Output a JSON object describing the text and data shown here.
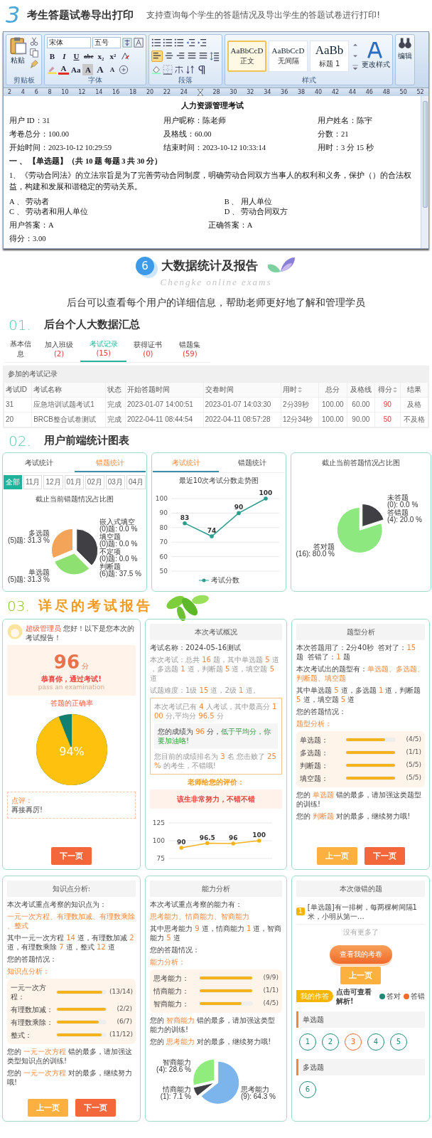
{
  "intro": {
    "number": "3",
    "title": "考生答题试卷导出打印",
    "subtitle": "支持查询每个学生的答题情况及导出学生的答题试卷进行打印!"
  },
  "word": {
    "clipboard": {
      "paste": "粘贴",
      "label": "剪贴板"
    },
    "font": {
      "name": "宋体",
      "size": "五号",
      "label": "字体",
      "row2": [
        {
          "text": "B",
          "kind": "bold"
        },
        {
          "text": "I",
          "kind": "italic"
        },
        {
          "text": "U",
          "kind": "underline"
        },
        {
          "text": "abe",
          "kind": "strike"
        },
        {
          "text": "x₂",
          "kind": "sub"
        },
        {
          "text": "x²",
          "kind": "sup"
        }
      ],
      "row3": [
        {
          "text": "A",
          "kind": "color"
        },
        {
          "text": "Aa",
          "kind": "case"
        },
        {
          "text": "A",
          "kind": "shade"
        },
        {
          "text": "A",
          "kind": "grow"
        },
        {
          "text": "A",
          "kind": "shrink"
        }
      ]
    },
    "paragraph": {
      "label": "段落",
      "align_buttons": [
        {
          "selected": true
        },
        {
          "selected": false
        },
        {
          "selected": false
        },
        {
          "selected": false
        },
        {
          "selected": false
        }
      ]
    },
    "styles": {
      "label": "样式",
      "change": "更改样式",
      "tiles": [
        {
          "sample": "AaBbCcD",
          "name": "正文",
          "kind": "normal",
          "selected": true
        },
        {
          "sample": "AaBbCcD",
          "name": "无间隔",
          "kind": "normal",
          "selected": false
        },
        {
          "sample": "AaBb",
          "name": "标题 1",
          "kind": "heading",
          "selected": false
        }
      ]
    },
    "editing": {
      "label": "编辑"
    },
    "ruler": [
      "2",
      "4",
      "6",
      "8",
      "10",
      "12",
      "14",
      "16",
      "18",
      "20",
      "22",
      "24",
      "28",
      "30",
      "32",
      "34",
      "36",
      "38",
      "40",
      "42",
      "44",
      "46",
      "48",
      "50",
      "52"
    ],
    "document": {
      "title": "人力资源管理考试",
      "fields": [
        [
          "用户 ID：31",
          "用户昵称：陈老师",
          "用户姓名：陈宇"
        ],
        [
          "考卷总分：100.00",
          "及格线：60.00",
          "分数：21"
        ],
        [
          "开始时间：2023-10-12 10:29:59",
          "结束时间：2023-10-12 10:33:14",
          "用时：3 分 15 秒"
        ]
      ],
      "section": "一 、 【单选题】（共 10 题 每题 3 共 30 分）",
      "question": "1、《劳动合同法》的立法宗旨是为了完善劳动合同制度，明确劳动合同双方当事人的权利和义务，保护（）的合法权益，构建和发展和谐稳定的劳动关系。",
      "options": [
        "A 、 劳动者",
        "B 、 用人单位",
        "C 、 劳动者和用人单位",
        "D 、 劳动合同双方"
      ],
      "user_answer": "用户答案：A",
      "correct_answer": "正确答案：A",
      "score": "得分：3.00"
    }
  },
  "big_data": {
    "number": "6",
    "title": "大数据统计及报告",
    "script": "Chengke online exams",
    "description": "后台可以查看每个用户的详细信息，帮助老师更好地了解和管理学员"
  },
  "summary": {
    "number": "01.",
    "title": "后台个人大数据汇总",
    "tabs": [
      {
        "label": "基本信息",
        "selected": false
      },
      {
        "label": "加入班级",
        "count": "(2)",
        "selected": false
      },
      {
        "label": "考试记录",
        "count": "(15)",
        "selected": true
      },
      {
        "label": "获得证书",
        "count": "(0)",
        "selected": false
      },
      {
        "label": "错题集",
        "count": "(59)",
        "selected": false
      }
    ],
    "table": {
      "caption": "参加的考试记录",
      "columns": [
        {
          "label": "考试ID",
          "sortable": false,
          "highlight": false
        },
        {
          "label": "考试名称",
          "sortable": false,
          "highlight": false
        },
        {
          "label": "状态",
          "sortable": false,
          "highlight": false
        },
        {
          "label": "开始答题时间",
          "sortable": false,
          "highlight": false
        },
        {
          "label": "交卷时间",
          "sortable": false,
          "highlight": false
        },
        {
          "label": "用时",
          "sortable": true,
          "highlight": false
        },
        {
          "label": "总分",
          "sortable": false,
          "highlight": false
        },
        {
          "label": "及格线",
          "sortable": false,
          "highlight": false
        },
        {
          "label": "得分",
          "sortable": true,
          "highlight": true
        },
        {
          "label": "结果",
          "sortable": false,
          "highlight": false
        }
      ],
      "rows": [
        [
          "31",
          "应急培训试题考试1",
          "完成",
          "2023-01-07 14:00:51",
          "2023-01-07 14:03:30",
          "2分39秒",
          "100.00",
          "60.00",
          "90",
          "及格"
        ],
        [
          "20",
          "BRCB整合试卷测试",
          "完成",
          "2022-04-11 08:44:54",
          "2022-04-11 08:57:28",
          "12分34秒",
          "100.00",
          "90.00",
          "50",
          "不及格"
        ]
      ]
    }
  },
  "charts": {
    "number": "02.",
    "title": "用户前端统计图表",
    "panels": [
      {
        "tabs": [
          {
            "label": "考试统计",
            "selected": false
          },
          {
            "label": "错题统计",
            "selected": true
          }
        ],
        "filters": [
          {
            "label": "全部",
            "selected": true
          },
          {
            "label": "11月",
            "selected": false
          },
          {
            "label": "12月",
            "selected": false
          },
          {
            "label": "01月",
            "selected": false
          },
          {
            "label": "02月",
            "selected": false
          },
          {
            "label": "03月",
            "selected": false
          },
          {
            "label": "04月",
            "selected": false
          }
        ],
        "chart_data": {
          "type": "pie",
          "title": "截止当前错题情况占比图",
          "categories": [
            "判断题",
            "单选题",
            "多选题",
            "嵌入式填空",
            "填空题",
            "不定项"
          ],
          "series": [
            {
              "values": [
                37.5,
                31.25,
                31.25,
                0,
                0,
                0
              ]
            }
          ],
          "value_labels": [
            "(6)题: 37.5 %",
            "(5)题: 31.3 %",
            "(5)题: 31.3 %",
            "(0)题: 0.0 %",
            "(0)题: 0.0 %",
            "(0)题: 0.0 %"
          ]
        }
      },
      {
        "tabs": [
          {
            "label": "考试统计",
            "selected": true
          },
          {
            "label": "错题统计",
            "selected": false
          }
        ],
        "chart_data": {
          "type": "line",
          "title": "最近10次考试分数走势图",
          "ylim": [
            50,
            100
          ],
          "yticks": [
            50,
            60,
            70,
            80,
            90,
            100
          ],
          "grid": true,
          "series": [
            {
              "name": "考试分数",
              "color": "#2a9d8f",
              "values": [
                83,
                74,
                90,
                100
              ]
            }
          ],
          "data_labels": true
        }
      },
      {
        "chart_data": {
          "type": "pie",
          "title": "截止当前答题情况占比图",
          "categories": [
            "未答题",
            "答错题",
            "答对题"
          ],
          "series": [
            {
              "values": [
                0,
                20,
                80
              ]
            }
          ],
          "value_labels": [
            "(0): 0.0 %",
            "(4): 20.0 %",
            "(16): 80.0 %"
          ]
        }
      }
    ]
  },
  "report": {
    "number": "03.",
    "title": "详尽的考试报告",
    "cards": [
      {
        "kind": "result",
        "greeting": "**超级管理员** 您好！以下是您本次的考试报告！",
        "score": "96",
        "unit": "分",
        "message": "恭喜你，通过考试!",
        "message_en": "pass an examination",
        "accuracy": {
          "title": "答题的正确率",
          "label": "94%",
          "level": 0.94
        },
        "comment": {
          "label": "点评：",
          "text": "再接再厉!"
        },
        "buttons": [
          {
            "label": "下一页",
            "kind": "next"
          }
        ]
      },
      {
        "kind": "overview",
        "header": "本次考试概况",
        "lines": [
          "考试名称：2024-05-16测试",
          "本次考试：总共 **16** 题，其中单选题 **5** 道，多选题 **1** 道，判断题 **5** 道，填空题 **5** 道",
          "试题难度：1级 **15** 道，2级 **1** 道。"
        ],
        "stats": "本次考试已有 **4** 人考试，其中最高分 **100** 分,平均分 **96.5** 分",
        "verdict": "您的成绩为 **96** 分，*低于平均分，你要加油咯!*",
        "rank": "您目前的成绩排名为 **3** 名 您击败了 **25%** 的考生，不错哦!",
        "teacher_title": "老师给您的评价：",
        "teacher_comment": "该生非常努力，不错不错",
        "chart_data": {
          "type": "line",
          "ylim": [
            75,
            125
          ],
          "yticks": [
            75,
            100,
            125
          ],
          "grid": true,
          "series": [
            {
              "color": "#f5b21b",
              "values": [
                90,
                96.5,
                96,
                100
              ]
            }
          ],
          "data_labels": true
        }
      },
      {
        "kind": "analysis",
        "header": "题型分析",
        "lines": [
          {
            "kind": "plain",
            "text": "本次答题用了：2分40秒  答对了：**15** 题  答错了：**1** 题"
          },
          {
            "kind": "plain",
            "text": "本次考试出的题型有：**单选题、多选题、判断题、填空题**"
          },
          {
            "kind": "plain",
            "text": "其中单选题 **5** 道，多选题 **1** 道，判断题 **5** 道，填空题 **5** 道"
          },
          {
            "kind": "plain",
            "text": "您的答题情况："
          },
          {
            "kind": "subtitle",
            "text": "题型分析："
          }
        ],
        "bars": [
          {
            "label": "单选题：",
            "reading": "(4/5)",
            "level": 0.8
          },
          {
            "label": "多选题：",
            "reading": "(1/1)",
            "level": 1
          },
          {
            "label": "判断题：",
            "reading": "(5/5)",
            "level": 1
          },
          {
            "label": "填空题：",
            "reading": "(5/5)",
            "level": 1
          }
        ],
        "remarks": [
          "您的 **单选题** 错的最多，请加强这类题型的训练!",
          "您的 **判断题** 对的最多，继续努力哦!"
        ],
        "buttons": [
          {
            "label": "上一页",
            "kind": "prev"
          },
          {
            "label": "下一页",
            "kind": "next"
          }
        ]
      },
      {
        "kind": "analysis",
        "header": "知识点分析:",
        "lines": [
          {
            "kind": "plain",
            "text": "本次考试重点考察的知识点为："
          },
          {
            "kind": "topic",
            "text": "一元一次方程、有理数加减、有理数乘除、整式"
          },
          {
            "kind": "plain",
            "text": "其中一元一次方程 **14** 道，有理数加减 **2** 道，有理数乘除 **7** 道，整式 **12** 道"
          },
          {
            "kind": "plain",
            "text": "您的答题情况："
          },
          {
            "kind": "subtitle",
            "text": "知识点分析："
          }
        ],
        "bars": [
          {
            "label": "一元一次方程：",
            "reading": "(13/14)",
            "level": 0.93
          },
          {
            "label": "有理数加减：",
            "reading": "(2/2)",
            "level": 1
          },
          {
            "label": "有理数乘除：",
            "reading": "(6/7)",
            "level": 0.86
          },
          {
            "label": "整式：",
            "reading": "(11/12)",
            "level": 0.92
          }
        ],
        "remarks": [
          "您的 **一元一次方程** 错的最多，请加强这类型知识点的训练!",
          "您的 **一元一次方程** 对的最多，继续努力哦!"
        ],
        "buttons": [
          {
            "label": "上一页",
            "kind": "prev"
          },
          {
            "label": "下一页",
            "kind": "next"
          }
        ]
      },
      {
        "kind": "analysis",
        "header": "能力分析",
        "lines": [
          {
            "kind": "plain",
            "text": "本次考试重点考察的能力有："
          },
          {
            "kind": "topic",
            "text": "思考能力、情商能力、智商能力"
          },
          {
            "kind": "plain",
            "text": "其中思考能力 **9** 道，情商能力 **1** 道，智商能力 **5** 道"
          },
          {
            "kind": "plain",
            "text": "您的答题情况："
          },
          {
            "kind": "subtitle",
            "text": "能力分析："
          }
        ],
        "bars": [
          {
            "label": "思考能力：",
            "reading": "(9/9)",
            "level": 1
          },
          {
            "label": "情商能力：",
            "reading": "(1/1)",
            "level": 1
          },
          {
            "label": "智商能力：",
            "reading": "(4/5)",
            "level": 0.8
          }
        ],
        "remarks": [
          "您的 **智商能力** 错的最多，请加强这类型能力的训练!",
          "您的 **思考能力** 对的最多，继续努力哦!"
        ],
        "chart_data": {
          "type": "pie",
          "categories": [
            "思考能力",
            "情商能力",
            "智商能力"
          ],
          "series": [
            {
              "values": [
                64.3,
                7.1,
                28.6
              ]
            }
          ],
          "value_labels": [
            "(9): 64.3 %",
            "(1): 7.1 %",
            "(4): 28.6 %"
          ]
        }
      },
      {
        "kind": "wrong",
        "header": "本次做错的题",
        "item": {
          "number": "1",
          "text": "[单选题]有一排树，每两棵树间隔1米，小明从第一…"
        },
        "no_more": "没有更多了",
        "view_button": "查看我的考卷",
        "prev_button": "上一页",
        "answer_tag": "我的作答",
        "hint": "点击可查看解析!",
        "legend": [
          {
            "label": "答对",
            "color": "#1a8a76"
          },
          {
            "label": "答错",
            "color": "#f06a2a"
          }
        ],
        "groups": [
          {
            "title": "单选题",
            "questions": [
              {
                "number": "1",
                "correct": true
              },
              {
                "number": "2",
                "correct": true
              },
              {
                "number": "3",
                "correct": false
              },
              {
                "number": "4",
                "correct": true
              },
              {
                "number": "5",
                "correct": true
              }
            ]
          },
          {
            "title": "多选题",
            "questions": [
              {
                "number": "6",
                "correct": true
              }
            ]
          }
        ]
      }
    ]
  }
}
